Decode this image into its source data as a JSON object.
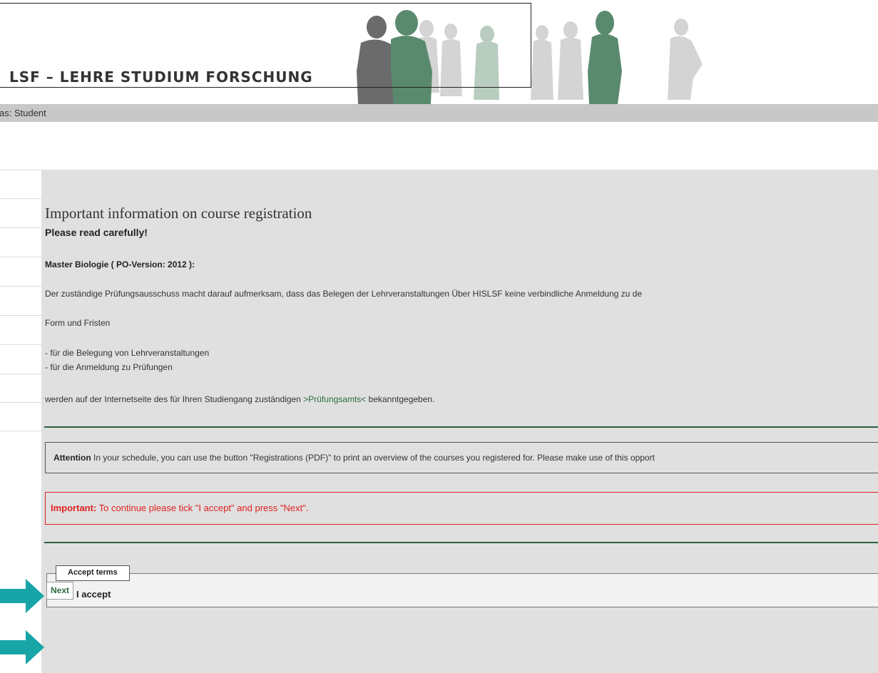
{
  "header": {
    "app_title": "LSF – LEHRE STUDIUM FORSCHUNG"
  },
  "status_bar": {
    "text": "as: Student"
  },
  "main": {
    "title": "Important information on course registration",
    "subtitle": "Please read carefully!",
    "program": "Master Biologie ( PO-Version: 2012 ):",
    "notice": "Der zuständige Prüfungsausschuss macht darauf aufmerksam, dass das Belegen der Lehrveranstaltungen Über HISLSF keine verbindliche Anmeldung zu de",
    "form_fristen": "Form und Fristen",
    "list": [
      "- für die Belegung von Lehrveranstaltungen",
      "- für die Anmeldung zu Prüfungen"
    ],
    "exam_office_prefix": "werden auf der Internetseite des für Ihren Studiengang zuständigen ",
    "exam_office_link": ">Prüfungsamts<",
    "exam_office_suffix": " bekanntgegeben.",
    "attention_label": "Attention",
    "attention_text": " In your schedule, you can use the button \"Registrations (PDF)\" to print an overview of the courses you registered for. Please make use of this opport",
    "important_label": "Important:",
    "important_text": " To continue please tick \"I accept\" and press \"Next\".",
    "accept_terms_legend": "Accept terms",
    "accept_label": "I accept",
    "accept_checked": false,
    "next_label": "Next"
  },
  "colors": {
    "accent_green": "#2c6b3f",
    "rule_green": "#2e5e3e",
    "important_red": "#e02020",
    "content_bg": "#e0e0e0",
    "status_bar_bg": "#c8c8c8",
    "arrow_teal": "#17a5a8"
  }
}
